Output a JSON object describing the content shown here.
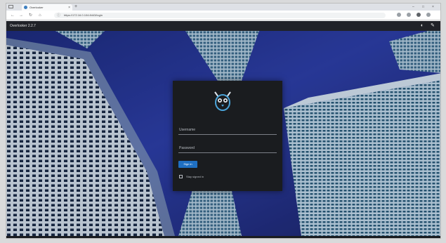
{
  "browser": {
    "tab_title": "Overlooker",
    "tab_close": "×",
    "new_tab": "+",
    "address": "https://172.16.0.104:8443/login",
    "window_minimize": "–",
    "window_maximize": "□",
    "window_close": "×"
  },
  "app": {
    "brand": "Overlooker 2.2.7",
    "theme_toggle_icon": "half-circle-icon",
    "settings_icon": "wrench-icon"
  },
  "login": {
    "username_placeholder": "Username",
    "password_placeholder": "Password",
    "signin_label": "Sign in",
    "remember_label": "Stay signed in"
  },
  "footer": {
    "left": "",
    "right": ""
  },
  "colors": {
    "accent": "#1f6fc2",
    "panel": "#1a1c1f",
    "appbar": "#202228"
  }
}
